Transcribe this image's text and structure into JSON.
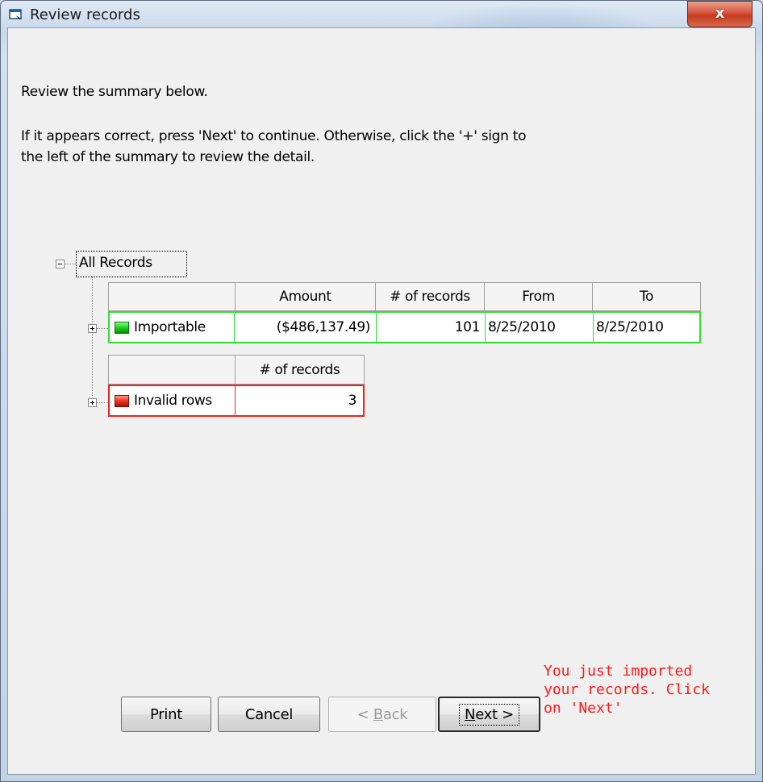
{
  "window": {
    "title": "Review records",
    "close_glyph": "x"
  },
  "intro": {
    "line1": "Review the summary below.",
    "line2a": "If it appears correct, press 'Next' to continue.  Otherwise, click the '+' sign to",
    "line2b": "the left of the summary to review the detail."
  },
  "tree": {
    "root_label": "All Records",
    "importable": {
      "label": "Importable",
      "status_color": "#20d020",
      "headers": [
        "Amount",
        "# of records",
        "From",
        "To"
      ],
      "values": [
        "($486,137.49)",
        "101",
        "8/25/2010",
        "8/25/2010"
      ]
    },
    "invalid": {
      "label": "Invalid rows",
      "status_color": "#ee3020",
      "headers": [
        "# of records"
      ],
      "values": [
        "3"
      ]
    }
  },
  "buttons": {
    "print": "Print",
    "cancel": "Cancel",
    "back_prefix": "< ",
    "back_mnemonic": "B",
    "back_rest": "ack",
    "next_mnemonic": "N",
    "next_rest": "ext >"
  },
  "note": {
    "line1": "You just imported",
    "line2": "your records. Click",
    "line3": "on 'Next'",
    "color": "#ff1a1a"
  }
}
